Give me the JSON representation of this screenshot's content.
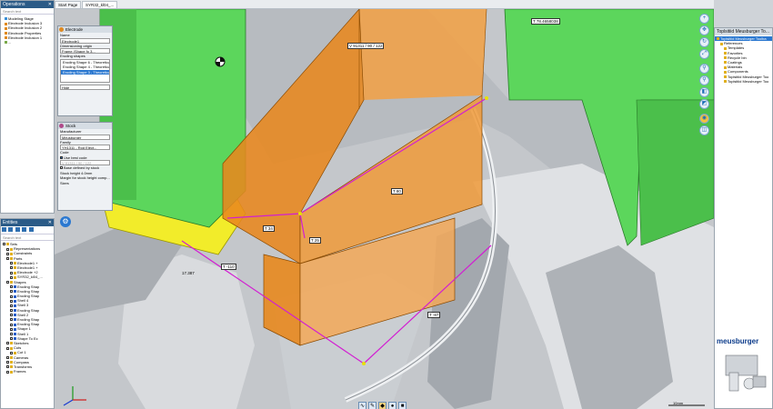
{
  "operations": {
    "title": "Operations",
    "close_label": "✕",
    "search_placeholder": "Search text",
    "items": [
      "Modeling Stage",
      "Electrode Inclusion 3",
      "Electrode Inclusion 2",
      "Electrode Properties",
      "Electrode Inclusion 1",
      "..."
    ]
  },
  "tabs": [
    {
      "label": "Start Page"
    },
    {
      "label": "SYR32_kl04_..."
    }
  ],
  "dialog_electrode": {
    "title": "Electrode",
    "name_label": "Name",
    "name_value": "Electrode1",
    "origin_label": "Dimensioning origin",
    "origin_value": "Frame (Shape fo 3...",
    "eroding_label": "Eroding shapes",
    "eroding_items": [
      "Eroding Shape 6 - Theoretical",
      "Eroding Shape 4 - Theoretical",
      "Eroding Shape 3 - Theoretical"
    ],
    "hide_label": "Hide"
  },
  "dialog_stock": {
    "title": "Stock",
    "manufacturer_label": "Manufacturer",
    "manufacturer_value": "Meusburger",
    "family_label": "Family",
    "family_value": "YH1311 - Rod Elect...",
    "code_label": "Code",
    "use_best_code": "Use best code",
    "code_value": "V 91311 / 90 / 122",
    "base_defined": "Base defined by stock",
    "stock_height": "Stock height 4.0mm",
    "margin": "Margin for stock height comp...",
    "sizes": "Sizes"
  },
  "entities": {
    "title": "Entities",
    "search_placeholder": "Search text",
    "items": [
      "Sets",
      "Representations",
      "Constraints",
      "Parts",
      "Electrode1 +",
      "Electrode1 +",
      "Electrode +2",
      "SYR32_kl04_...",
      "Shapes",
      "Eroding Shap",
      "Eroding Shap",
      "Eroding Shap",
      "Shell 4",
      "Shell 3",
      "Eroding Shap",
      "Shell 2",
      "Eroding Shap",
      "Eroding Shap",
      "Shape 1",
      "Shell 1",
      "Shape To Ec",
      "Sketches",
      "Cuts",
      "Cut 1",
      "Cameras",
      "Compass",
      "Transforms",
      "Frames"
    ]
  },
  "viewport": {
    "dims": [
      "V 91311 / 90 / 122",
      "T 78.4658038",
      "T 80",
      "T 34",
      "T 25",
      "T -110",
      "T -87",
      "17.387"
    ],
    "scale_label": "10mm",
    "highlight_color": "#e8881e",
    "green_color": "#5cd65c"
  },
  "right_panel": {
    "title": "Toplsitiid Meusburger To...",
    "items": [
      "Toplsitiid Meusburger Toolba",
      "References",
      "Templates",
      "Favorites",
      "Recycle bin",
      "Coatings",
      "Materials",
      "Components",
      "Toplsitiid Meusburger Too",
      "Toplsitiid Meusburger Too"
    ],
    "brand": "meusburger"
  }
}
